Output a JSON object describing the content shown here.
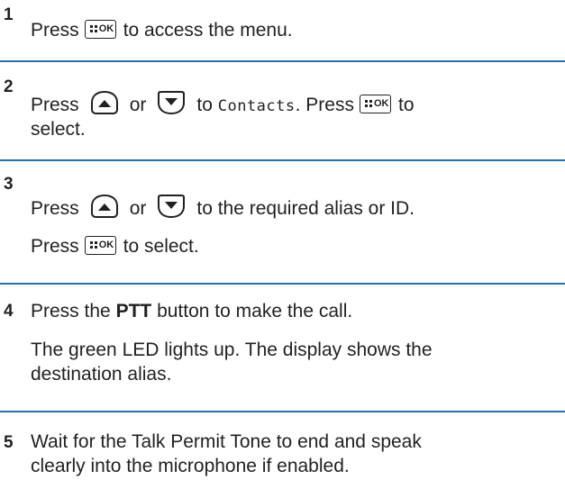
{
  "steps": [
    {
      "number": "1",
      "lines": {
        "l1": {
          "a": "Press",
          "b": "to access the menu."
        }
      }
    },
    {
      "number": "2",
      "lines": {
        "l1": {
          "a": "Press",
          "b": "or",
          "c": "to",
          "d": "Contacts",
          "e": ". Press",
          "f": "to"
        },
        "l2": {
          "a": "select."
        }
      }
    },
    {
      "number": "3",
      "lines": {
        "l1": {
          "a": "Press",
          "b": "or",
          "c": "to the required alias or ID."
        },
        "l2": {
          "a": "Press",
          "b": "to select."
        }
      }
    },
    {
      "number": "4",
      "lines": {
        "l1": {
          "a": "Press the",
          "b": "PTT",
          "c": "button to make the call."
        },
        "l2": {
          "a": "The green LED lights up. The display shows the"
        },
        "l3": {
          "a": "destination alias."
        }
      }
    },
    {
      "number": "5",
      "lines": {
        "l1": {
          "a": "Wait for the Talk Permit Tone to end and speak"
        },
        "l2": {
          "a": "clearly into the microphone if enabled."
        }
      }
    }
  ],
  "keys": {
    "ok_label": "OK",
    "ok_icon": "menu-ok-key-icon",
    "up_icon": "up-navigation-key-icon",
    "down_icon": "down-navigation-key-icon"
  },
  "colors": {
    "divider": "#2b6fa8",
    "text": "#231f20"
  }
}
